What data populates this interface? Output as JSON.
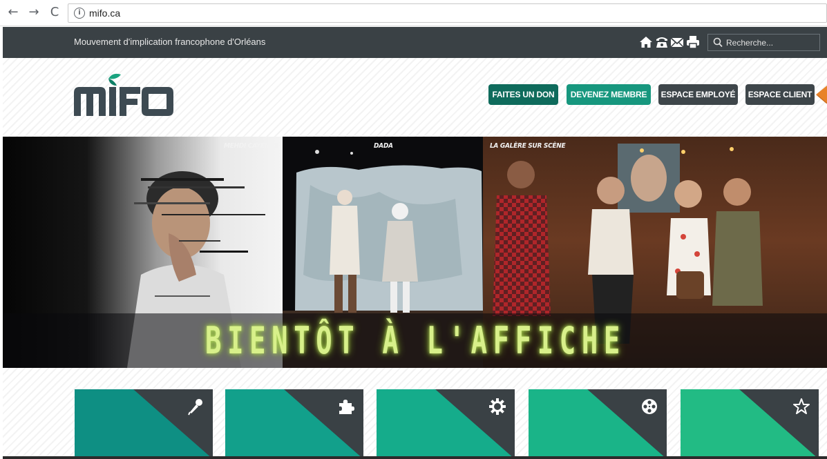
{
  "browser": {
    "url": "mifo.ca",
    "back_icon": "←",
    "forward_icon": "→",
    "reload_icon": "C",
    "info_icon": "i"
  },
  "topbar": {
    "org_name": "Mouvement d'implication francophone d'Orléans",
    "search_placeholder": "Recherche...",
    "icons": [
      "home-icon",
      "phone-icon",
      "mail-icon",
      "print-icon",
      "search-icon"
    ]
  },
  "header": {
    "logo_text": "MIFO",
    "buttons": {
      "donate": "FAITES UN DON",
      "member": "DEVENEZ MEMBRE",
      "employee": "ESPACE EMPLOYÉ",
      "client": "ESPACE CLIENT"
    }
  },
  "banner": {
    "panels": [
      "MEHDI CAYENNE",
      "DADA",
      "LA GALÈRE SUR SCÈNE"
    ],
    "title": "BIENTÔT À L'AFFICHE"
  },
  "cards": [
    {
      "icon": "microphone-icon",
      "color": "#0e8f83"
    },
    {
      "icon": "puzzle-icon",
      "color": "#12a08b"
    },
    {
      "icon": "gear-icon",
      "color": "#15ac8b"
    },
    {
      "icon": "film-reel-icon",
      "color": "#1ab488"
    },
    {
      "icon": "star-icon",
      "color": "#22bb84"
    }
  ],
  "colors": {
    "topbar": "#3a4145",
    "donate": "#0f6b5c",
    "member": "#17977e",
    "dark_button": "#3e464a",
    "banner_title": "#d8f08a",
    "accent_orange": "#e8832a"
  }
}
